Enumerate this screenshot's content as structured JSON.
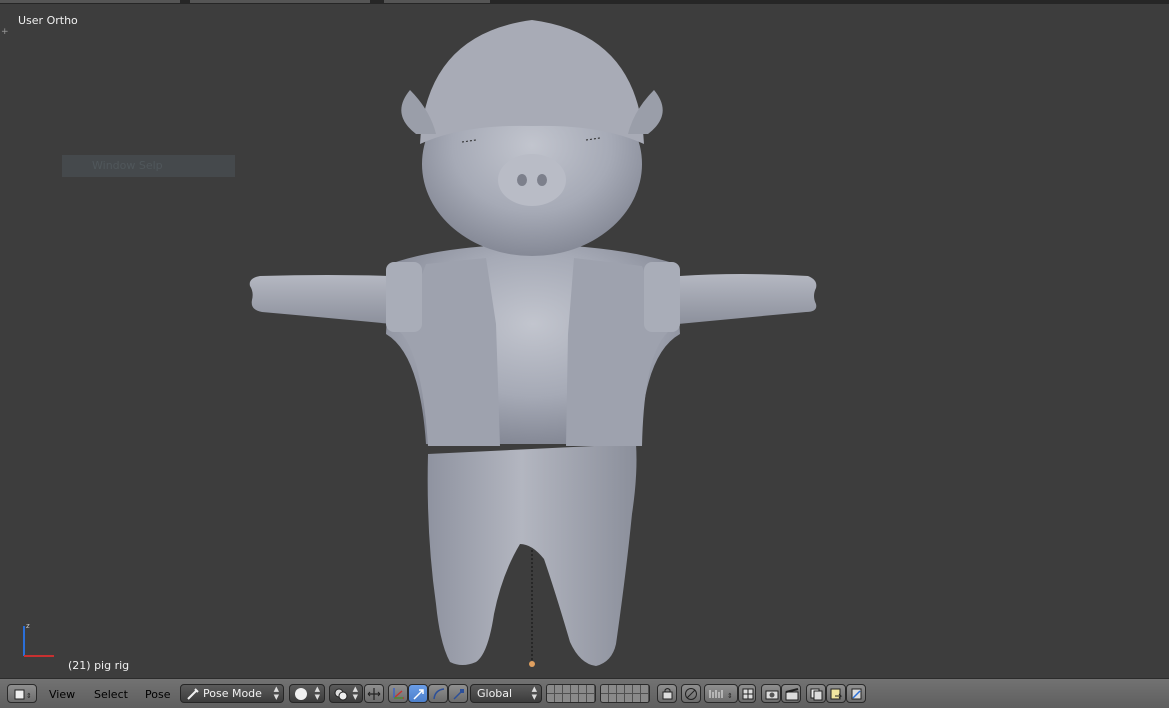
{
  "viewport": {
    "view_label": "User Ortho",
    "object_label": "(21) pig rig",
    "ghost_panel_label": "Window Selp"
  },
  "header": {
    "menus": {
      "view": "View",
      "select": "Select",
      "pose": "Pose"
    },
    "mode_label": "Pose Mode",
    "orientation_label": "Global"
  },
  "colors": {
    "viewport_bg": "#3d3d3d",
    "header_bg": "#6a6a6a",
    "mesh": "#a4a8b4",
    "text_light": "#f0f0f0",
    "manipulator_active": "#5b8fd6"
  },
  "icons": {
    "editor_type": "3d-view-cube-icon",
    "mode": "pose-bone-icon",
    "shading": "solid-sphere-icon",
    "pivot": "pivot-point-icon",
    "manipulator": "manipulator-axis-icon",
    "translate": "translate-arrow-icon",
    "rotate": "rotate-arc-icon",
    "scale": "scale-icon",
    "layers": "layer-grid-icon",
    "lock": "lock-layer-icon",
    "proportional": "proportional-edit-icon",
    "snap": "magnet-snap-icon",
    "snap_element": "snap-increment-icon",
    "render_still": "camera-render-icon",
    "render_anim": "clapper-render-icon",
    "copy_pose": "copy-pose-icon",
    "paste_pose": "paste-pose-icon",
    "paste_flipped": "paste-flipped-pose-icon"
  }
}
